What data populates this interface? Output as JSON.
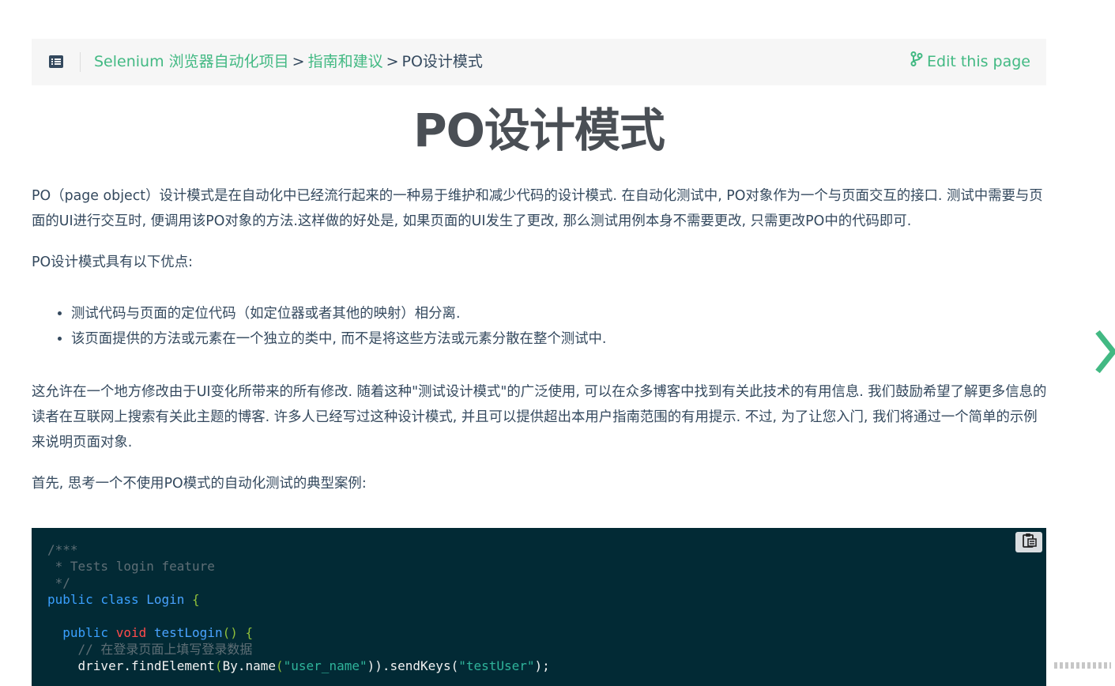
{
  "breadcrumb": {
    "link1": "Selenium 浏览器自动化项目",
    "sep1": ">",
    "link2": "指南和建议",
    "sep2": ">",
    "current": "PO设计模式"
  },
  "edit_link": "Edit this page",
  "title": "PO设计模式",
  "paragraphs": {
    "p1": "PO（page object）设计模式是在自动化中已经流行起来的一种易于维护和减少代码的设计模式. 在自动化测试中, PO对象作为一个与页面交互的接口. 测试中需要与页面的UI进行交互时, 便调用该PO对象的方法.这样做的好处是, 如果页面的UI发生了更改, 那么测试用例本身不需要更改, 只需更改PO中的代码即可.",
    "p2": "PO设计模式具有以下优点:",
    "p3": "这允许在一个地方修改由于UI变化所带来的所有修改. 随着这种\"测试设计模式\"的广泛使用, 可以在众多博客中找到有关此技术的有用信息. 我们鼓励希望了解更多信息的读者在互联网上搜索有关此主题的博客. 许多人已经写过这种设计模式, 并且可以提供超出本用户指南范围的有用提示. 不过, 为了让您入门, 我们将通过一个简单的示例来说明页面对象.",
    "p4": "首先, 思考一个不使用PO模式的自动化测试的典型案例:"
  },
  "bullets": [
    "测试代码与页面的定位代码（如定位器或者其他的映射）相分离.",
    "该页面提供的方法或元素在一个独立的类中, 而不是将这些方法或元素分散在整个测试中."
  ],
  "code": {
    "l1": "/***",
    "l2": " * Tests login feature",
    "l3": " */",
    "l4_kw": "public class",
    "l4_name": "Login",
    "l4_brace": "{",
    "l6_kw": "public",
    "l6_void": "void",
    "l6_fn": "testLogin",
    "l6_paren": "()",
    "l6_brace": "{",
    "l7": "// 在登录页面上填写登录数据",
    "l8_a": "driver.findElement",
    "l8_b": "(",
    "l8_c": "By.name",
    "l8_d": "(",
    "l8_s1": "\"user_name\"",
    "l8_e": ")).sendKeys(",
    "l8_s2": "\"testUser\"",
    "l8_f": ");"
  },
  "colors": {
    "accent": "#42b983",
    "text": "#34495e",
    "code_bg": "#022a35"
  },
  "icons": [
    "toc-icon",
    "git-branch-icon",
    "next-page-arrow-icon",
    "copy-clipboard-icon"
  ]
}
